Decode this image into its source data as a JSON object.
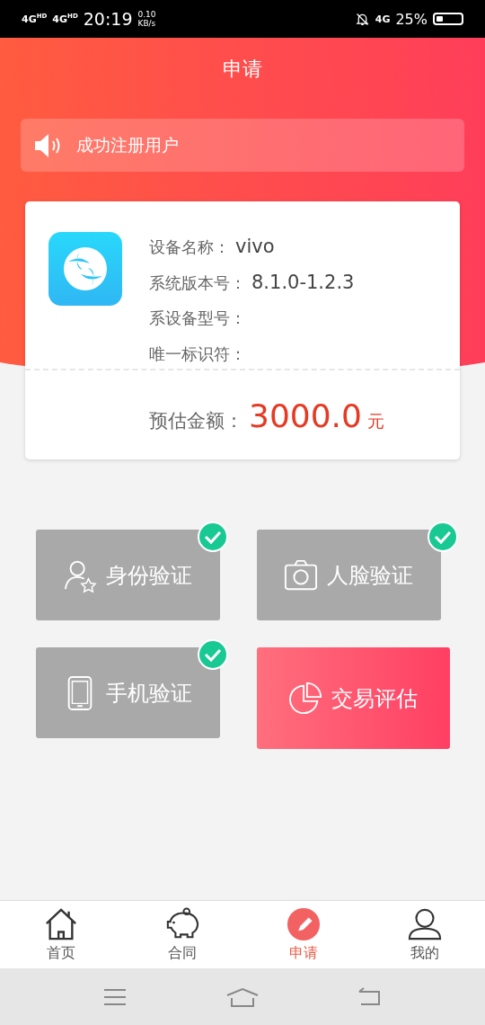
{
  "status_bar": {
    "signals": [
      {
        "label": "4G",
        "sup": "HD"
      },
      {
        "label": "4G",
        "sup": "HD"
      }
    ],
    "time": "20:19",
    "speed": "0.10",
    "speed_unit": "KB/s",
    "network": "4G",
    "battery_text": "25%",
    "battery": {
      "level": 0.25
    }
  },
  "header": {
    "title": "申请"
  },
  "notice": {
    "text": "成功注册用户"
  },
  "device": {
    "rows": [
      {
        "label": "设备名称：",
        "value": "vivo"
      },
      {
        "label": "系统版本号：",
        "value": "8.1.0-1.2.3"
      },
      {
        "label": "系设备型号："
      },
      {
        "label": "唯一标识符："
      }
    ],
    "amount_label": "预估金额：",
    "amount": "3000.0",
    "unit": "元"
  },
  "actions": [
    {
      "kind": "identity",
      "label": "身份验证",
      "done": true
    },
    {
      "kind": "face",
      "label": "人脸验证",
      "done": true
    },
    {
      "kind": "phone",
      "label": "手机验证",
      "done": true
    },
    {
      "kind": "assess",
      "label": "交易评估",
      "done": false
    }
  ],
  "tabs": [
    {
      "kind": "home",
      "label": "首页",
      "selected": false
    },
    {
      "kind": "contract",
      "label": "合同",
      "selected": false
    },
    {
      "kind": "apply",
      "label": "申请",
      "selected": true
    },
    {
      "kind": "me",
      "label": "我的",
      "selected": false
    }
  ]
}
